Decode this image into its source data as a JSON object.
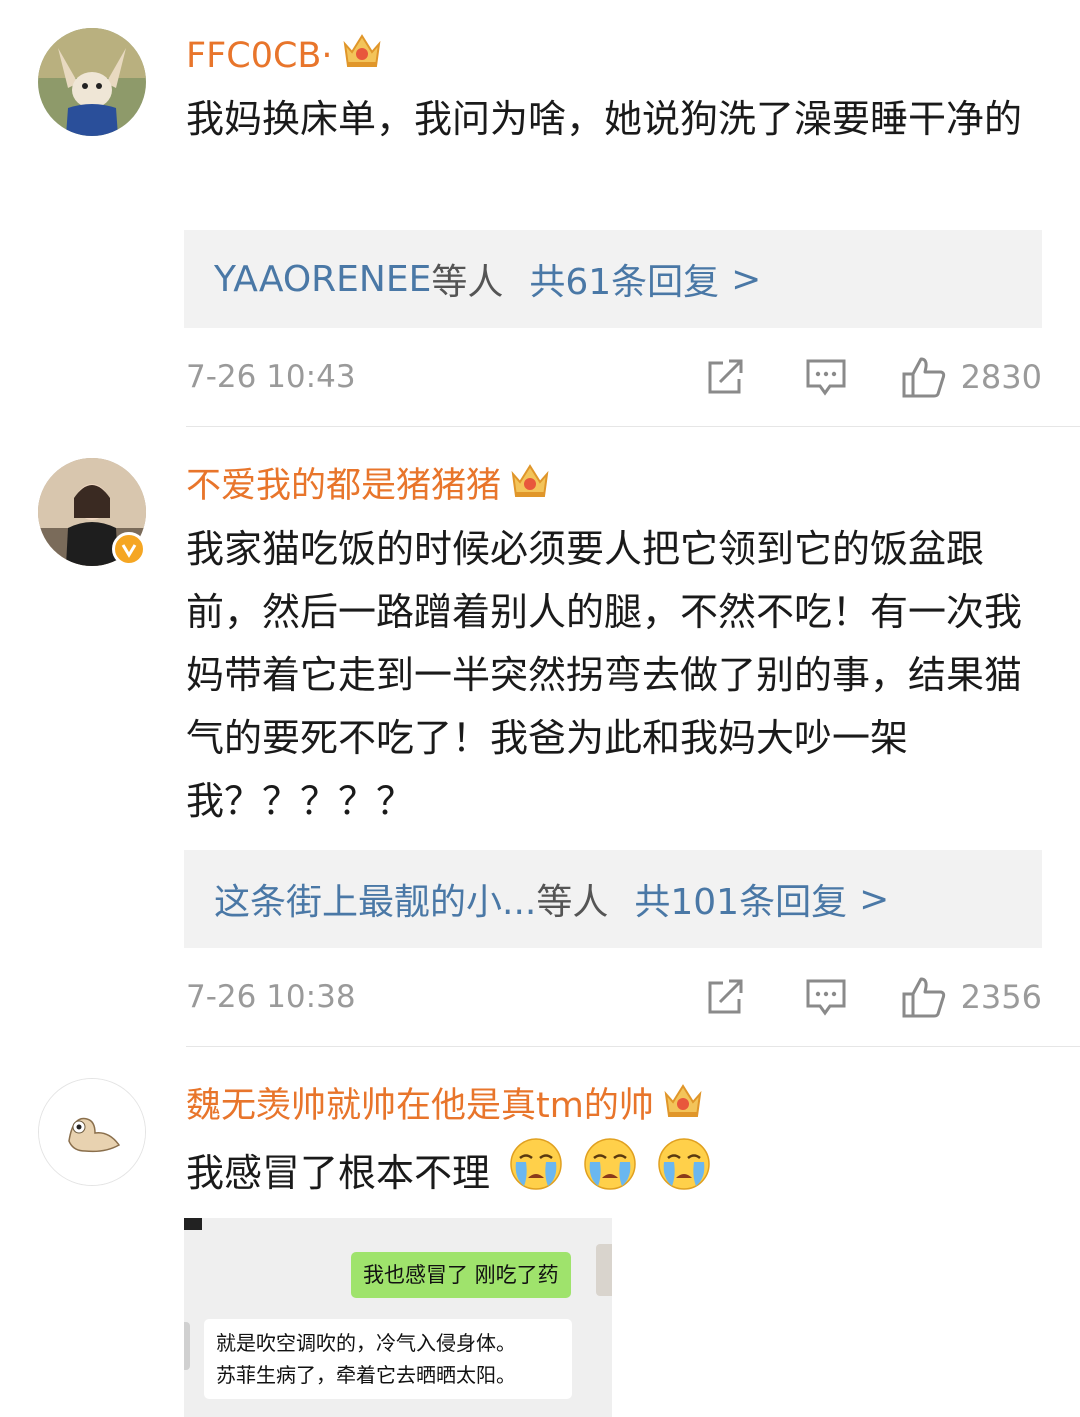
{
  "comments": [
    {
      "username": "FFC0CB·",
      "text": "我妈换床单，我问为啥，她说狗洗了澡要睡干净的",
      "reply_user": "YAAORENEE",
      "reply_others": "等人",
      "reply_count": "共61条回复",
      "reply_arrow": ">",
      "time": "7-26 10:43",
      "likes": "2830"
    },
    {
      "username": "不爱我的都是猪猪猪",
      "text": "我家猫吃饭的时候必须要人把它领到它的饭盆跟前，然后一路蹭着别人的腿，不然不吃！有一次我妈带着它走到一半突然拐弯去做了别的事，结果猫气的要死不吃了！我爸为此和我妈大吵一架我？？？？？",
      "reply_user": "这条街上最靓的小...",
      "reply_others": "等人",
      "reply_count": "共101条回复",
      "reply_arrow": ">",
      "time": "7-26 10:38",
      "likes": "2356"
    },
    {
      "username": "魏无羡帅就帅在他是真tm的帅",
      "text": "我感冒了根本不理",
      "emojis": [
        "crying-face-icon",
        "crying-face-icon",
        "crying-face-icon"
      ]
    }
  ],
  "screenshot": {
    "green_message": "我也感冒了 刚吃了药",
    "white_message_line1": "就是吹空调吹的，冷气入侵身体。",
    "white_message_line2": "苏菲生病了，牵着它去晒晒太阳。"
  },
  "icons": {
    "share": "share-icon",
    "comment": "comment-icon",
    "like": "thumbs-up-icon",
    "crown": "crown-badge-icon",
    "verified": "verified-badge-icon"
  },
  "colors": {
    "username": "#e8752b",
    "link": "#4a78a6",
    "meta": "#9a9a9a",
    "reply_bg": "#f2f2f2",
    "crown": "#f0a030"
  }
}
